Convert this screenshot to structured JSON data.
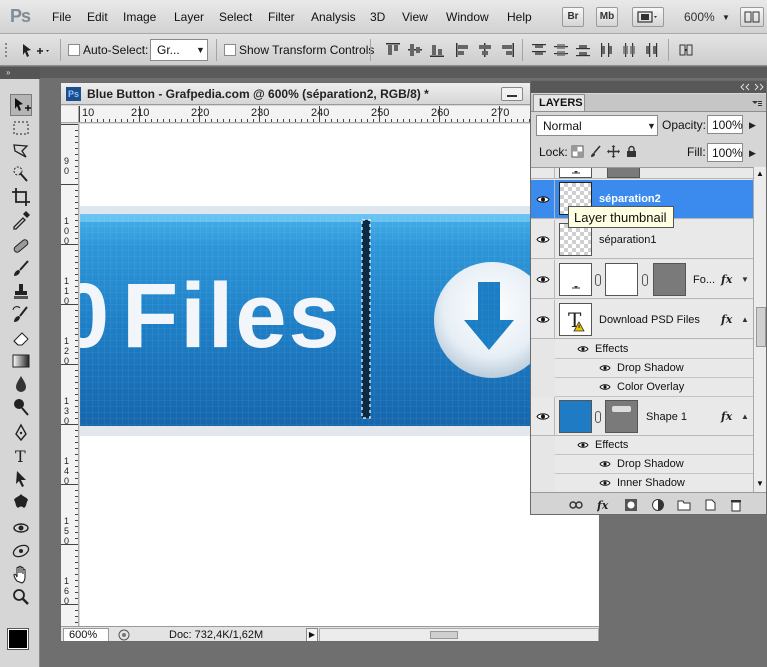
{
  "app": {
    "logo": "Ps",
    "menus": [
      "File",
      "Edit",
      "Image",
      "Layer",
      "Select",
      "Filter",
      "Analysis",
      "3D",
      "View",
      "Window",
      "Help"
    ],
    "bridge_label": "Br",
    "minibridge_label": "Mb",
    "zoom": "600%"
  },
  "options": {
    "auto_select_label": "Auto-Select:",
    "auto_select_value": "Gr...",
    "show_transform_label": "Show Transform Controls"
  },
  "document": {
    "title": "Blue Button - Grafpedia.com @ 600% (séparation2, RGB/8) *",
    "ruler_h": [
      "10",
      "210",
      "220",
      "230",
      "240",
      "250",
      "260",
      "270"
    ],
    "ruler_v": [
      "90",
      "100",
      "110",
      "120",
      "130",
      "140",
      "150",
      "160"
    ],
    "canvas_text": "Files",
    "canvas_partial_digit": "0",
    "status_zoom": "600%",
    "status_doc": "Doc: 732,4K/1,62M"
  },
  "layers_panel": {
    "tab_label": "LAYERS",
    "blend_mode": "Normal",
    "opacity_label": "Opacity:",
    "opacity_value": "100%",
    "lock_label": "Lock:",
    "fill_label": "Fill:",
    "fill_value": "100%",
    "layers": [
      {
        "name": "séparation2",
        "selected": true
      },
      {
        "name": "séparation1",
        "selected": false
      },
      {
        "name": "Fo...",
        "selected": false
      },
      {
        "name": "Download PSD Files",
        "selected": false
      },
      {
        "name": "Shape 1",
        "selected": false
      }
    ],
    "text_layer_effects_label": "Effects",
    "text_layer_effects": [
      "Drop Shadow",
      "Color Overlay"
    ],
    "shape_effects_label": "Effects",
    "shape_effects": [
      "Drop Shadow",
      "Inner Shadow"
    ],
    "fx_label": "fx",
    "tooltip": "Layer thumbnail"
  },
  "colors": {
    "accent_selected": "#3b8bef",
    "button_blue": "#1e7bc4"
  }
}
